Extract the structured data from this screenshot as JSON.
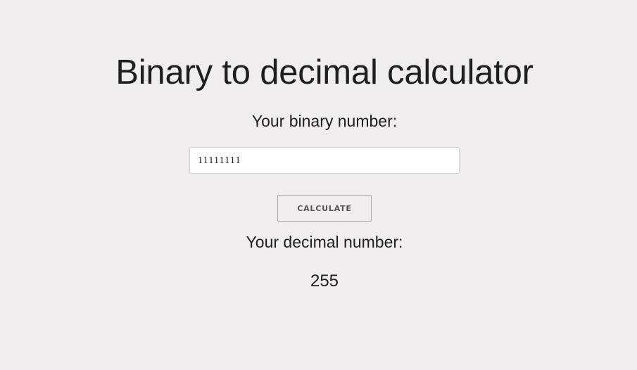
{
  "title": "Binary to decimal calculator",
  "binary_label": "Your binary number:",
  "binary_input": {
    "value": "11111111"
  },
  "calculate_button": {
    "label": "CALCULATE"
  },
  "decimal_label": "Your decimal number:",
  "result_value": "255",
  "colors": {
    "background": "#efedee",
    "text": "#1f1f1f",
    "input_background": "#ffffff",
    "button_text": "#555555"
  }
}
